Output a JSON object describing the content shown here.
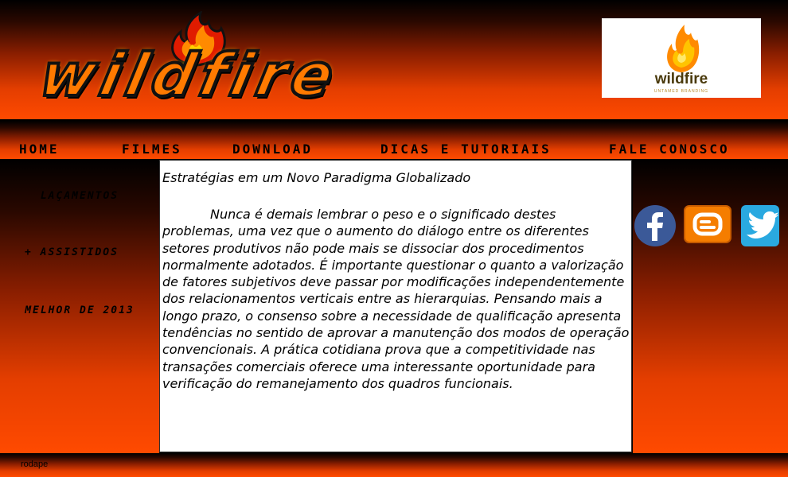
{
  "header": {
    "logo_text": "wildfire",
    "brand": {
      "name": "wildfire",
      "tagline": "UNTAMED BRANDING"
    }
  },
  "nav": {
    "items": [
      {
        "label": "HOME"
      },
      {
        "label": "FILMES"
      },
      {
        "label": "DOWNLOAD"
      },
      {
        "label": "DICAS E TUTORIAIS"
      },
      {
        "label": "FALE CONOSCO"
      }
    ]
  },
  "sidebar": {
    "items": [
      {
        "label": "LAÇAMENTOS"
      },
      {
        "label": "+ ASSISTIDOS"
      },
      {
        "label": "MELHOR DE 2013"
      }
    ]
  },
  "article": {
    "title": "Estratégias em um Novo Paradigma Globalizado",
    "body": "Nunca é demais lembrar o peso e o significado destes problemas, uma vez que o aumento do diálogo entre os diferentes setores produtivos não pode mais se dissociar dos procedimentos normalmente adotados. É importante questionar o quanto a valorização de fatores subjetivos deve passar por modificações independentemente dos relacionamentos verticais entre as hierarquias. Pensando mais a longo prazo, o consenso sobre a necessidade de qualificação apresenta tendências no sentido de aprovar a manutenção dos modos de operação convencionais. A prática cotidiana prova que a competitividade nas transações comerciais oferece uma interessante oportunidade para verificação do remanejamento dos quadros funcionais."
  },
  "social": [
    {
      "icon": "facebook-icon",
      "color": "#3b5998"
    },
    {
      "icon": "blogger-icon",
      "color": "#f57d00"
    },
    {
      "icon": "twitter-icon",
      "color": "#2aa9e0"
    }
  ],
  "footer": {
    "text": "rodape"
  },
  "colors": {
    "accent": "#ff4a00",
    "background": "#000000"
  }
}
